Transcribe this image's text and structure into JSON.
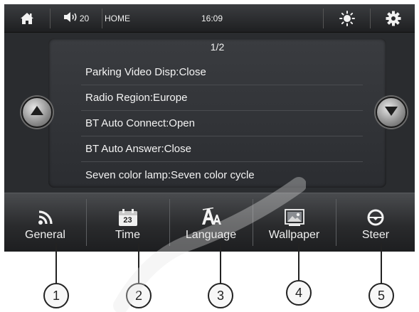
{
  "topbar": {
    "volume": "20",
    "mode": "HOME",
    "clock": "16:09",
    "icons": [
      "home-icon",
      "speaker-icon",
      "brightness-icon",
      "gear-icon"
    ]
  },
  "panel": {
    "page": "1/2",
    "items": [
      {
        "label": "Parking Video Disp:Close"
      },
      {
        "label": "Radio Region:Europe"
      },
      {
        "label": "BT Auto Connect:Open"
      },
      {
        "label": "BT Auto Answer:Close"
      },
      {
        "label": "Seven color lamp:Seven color cycle"
      }
    ]
  },
  "tabs": [
    {
      "label": "General",
      "icon": "rss-icon"
    },
    {
      "label": "Time",
      "icon": "calendar-icon",
      "icon_text": "23"
    },
    {
      "label": "Language",
      "icon": "font-icon"
    },
    {
      "label": "Wallpaper",
      "icon": "picture-icon"
    },
    {
      "label": "Steer",
      "icon": "steering-wheel-icon"
    }
  ],
  "callouts": [
    "1",
    "2",
    "3",
    "4",
    "5"
  ],
  "colors": {
    "screen_bg": "#2a2c2f",
    "text": "#f4f4f4"
  }
}
